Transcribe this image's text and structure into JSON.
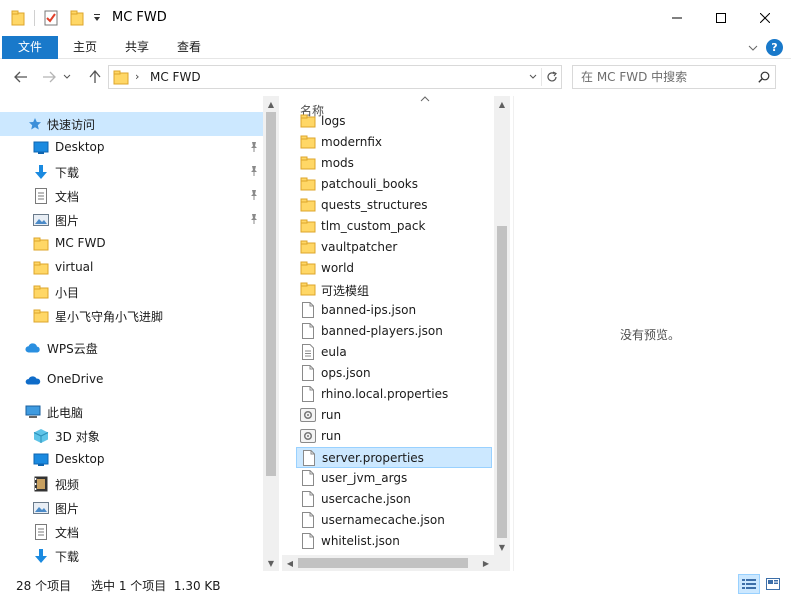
{
  "window": {
    "title": "MC FWD",
    "controls": {
      "minimize": "minimize",
      "maximize": "maximize",
      "close": "close"
    }
  },
  "ribbon": {
    "tabs": [
      {
        "label": "文件"
      },
      {
        "label": "主页"
      },
      {
        "label": "共享"
      },
      {
        "label": "查看"
      }
    ],
    "help": "?"
  },
  "address": {
    "path": "MC FWD",
    "search_placeholder": "在 MC FWD 中搜索"
  },
  "nav": {
    "items": [
      {
        "label": "快速访问",
        "icon": "star-icon",
        "pinned": false
      },
      {
        "label": "Desktop",
        "icon": "desktop-icon",
        "pinned": true
      },
      {
        "label": "下载",
        "icon": "download-icon",
        "pinned": true
      },
      {
        "label": "文档",
        "icon": "document-icon",
        "pinned": true
      },
      {
        "label": "图片",
        "icon": "pictures-icon",
        "pinned": true
      },
      {
        "label": "MC FWD",
        "icon": "folder-icon",
        "pinned": false
      },
      {
        "label": "virtual",
        "icon": "folder-icon",
        "pinned": false
      },
      {
        "label": "小目",
        "icon": "folder-icon",
        "pinned": false
      },
      {
        "label": "星小飞守角小飞进脚",
        "icon": "folder-icon",
        "pinned": false
      },
      {
        "label": "WPS云盘",
        "icon": "cloud-icon",
        "pinned": false
      },
      {
        "label": "OneDrive",
        "icon": "onedrive-icon",
        "pinned": false
      },
      {
        "label": "此电脑",
        "icon": "computer-icon",
        "pinned": false
      },
      {
        "label": "3D 对象",
        "icon": "3d-objects-icon",
        "pinned": false
      },
      {
        "label": "Desktop",
        "icon": "desktop-icon",
        "pinned": false
      },
      {
        "label": "视频",
        "icon": "video-icon",
        "pinned": false
      },
      {
        "label": "图片",
        "icon": "pictures-icon",
        "pinned": false
      },
      {
        "label": "文档",
        "icon": "document-icon",
        "pinned": false
      },
      {
        "label": "下载",
        "icon": "download-icon",
        "pinned": false
      }
    ]
  },
  "files": {
    "column_name": "名称",
    "rows": [
      {
        "name": "logs",
        "type": "folder"
      },
      {
        "name": "modernfix",
        "type": "folder"
      },
      {
        "name": "mods",
        "type": "folder"
      },
      {
        "name": "patchouli_books",
        "type": "folder"
      },
      {
        "name": "quests_structures",
        "type": "folder"
      },
      {
        "name": "tlm_custom_pack",
        "type": "folder"
      },
      {
        "name": "vaultpatcher",
        "type": "folder"
      },
      {
        "name": "world",
        "type": "folder"
      },
      {
        "name": "可选模组",
        "type": "folder"
      },
      {
        "name": "banned-ips.json",
        "type": "file"
      },
      {
        "name": "banned-players.json",
        "type": "file"
      },
      {
        "name": "eula",
        "type": "text"
      },
      {
        "name": "ops.json",
        "type": "file"
      },
      {
        "name": "rhino.local.properties",
        "type": "file"
      },
      {
        "name": "run",
        "type": "script"
      },
      {
        "name": "run",
        "type": "script"
      },
      {
        "name": "server.properties",
        "type": "file",
        "selected": true
      },
      {
        "name": "user_jvm_args",
        "type": "file"
      },
      {
        "name": "usercache.json",
        "type": "file"
      },
      {
        "name": "usernamecache.json",
        "type": "file"
      },
      {
        "name": "whitelist.json",
        "type": "file"
      }
    ]
  },
  "preview": {
    "message": "没有预览。"
  },
  "status": {
    "item_count": "28 个项目",
    "selection": "选中 1 个项目  1.30 KB"
  },
  "colors": {
    "accent": "#1979ca",
    "selection": "#cce8ff",
    "folder": "#ffd766"
  }
}
